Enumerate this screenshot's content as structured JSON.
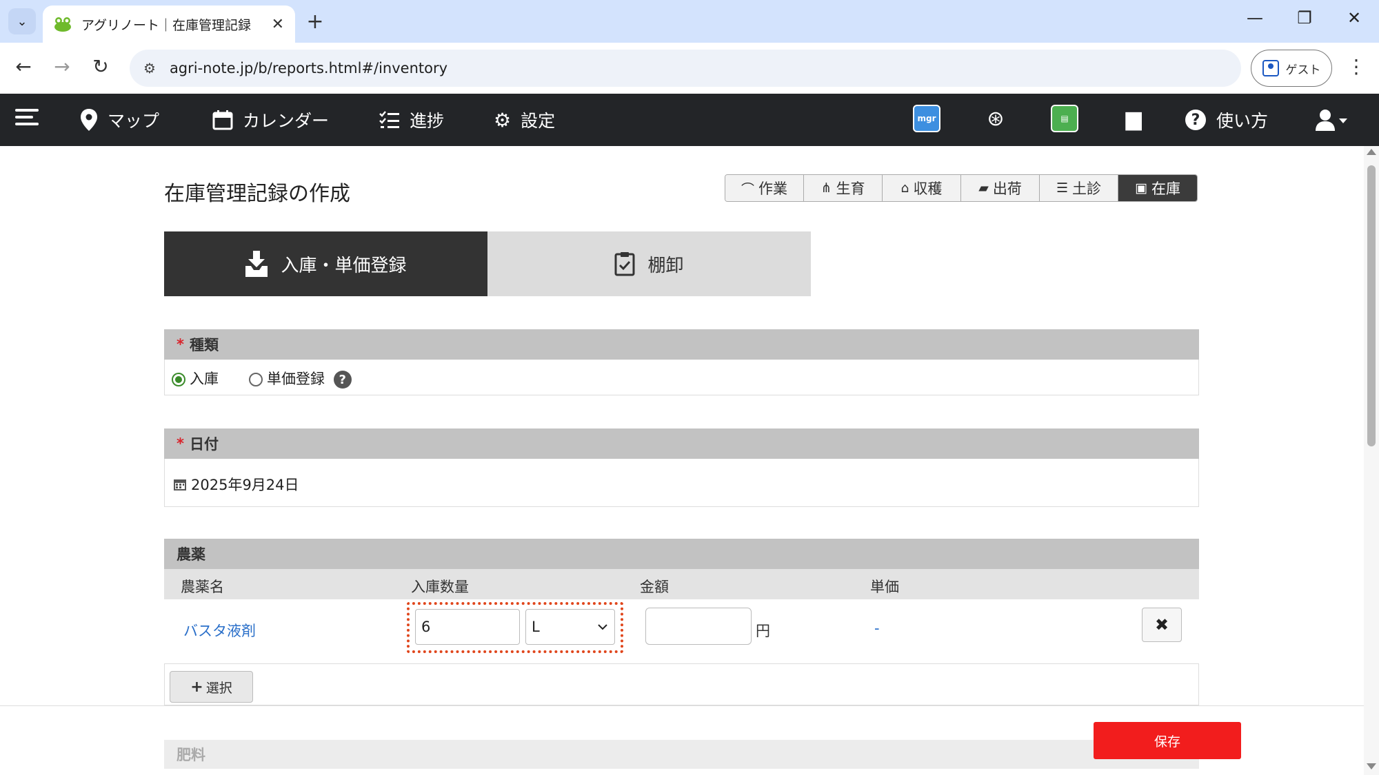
{
  "browser": {
    "tab_title": "アグリノート｜在庫管理記録",
    "url": "agri-note.jp/b/reports.html#/inventory",
    "guest_label": "ゲスト"
  },
  "appnav": {
    "map_label": "マップ",
    "calendar_label": "カレンダー",
    "progress_label": "進捗",
    "settings_label": "設定",
    "mgr_label": "mgr",
    "help_label": "使い方"
  },
  "page": {
    "title": "在庫管理記録の作成"
  },
  "record_types": [
    {
      "label": "作業"
    },
    {
      "label": "生育"
    },
    {
      "label": "収穫"
    },
    {
      "label": "出荷"
    },
    {
      "label": "土診"
    },
    {
      "label": "在庫"
    }
  ],
  "mode_tabs": {
    "stock_in": "入庫・単価登録",
    "inventory": "棚卸"
  },
  "type_section": {
    "heading": "種類",
    "required_mark": "*",
    "option_stock_in": "入庫",
    "option_unit_price": "単価登録",
    "help_glyph": "?"
  },
  "date_section": {
    "heading": "日付",
    "required_mark": "*",
    "value": "2025年9月24日"
  },
  "pesticide_section": {
    "heading": "農薬",
    "columns": {
      "name": "農薬名",
      "quantity": "入庫数量",
      "amount": "金額",
      "unit_price": "単価"
    },
    "rows": [
      {
        "name": "バスタ液剤",
        "quantity": "6",
        "unit": "L",
        "amount": "",
        "currency": "円",
        "unit_price": "-"
      }
    ],
    "select_label": "選択"
  },
  "fertilizer_section": {
    "heading": "肥料"
  },
  "footer": {
    "save_label": "保存"
  },
  "colors": {
    "nav_bg": "#232528",
    "accent_save": "#f21d1d",
    "link": "#2a6fc9",
    "highlight": "#e0461c",
    "radio_checked": "#3a8b2a"
  }
}
